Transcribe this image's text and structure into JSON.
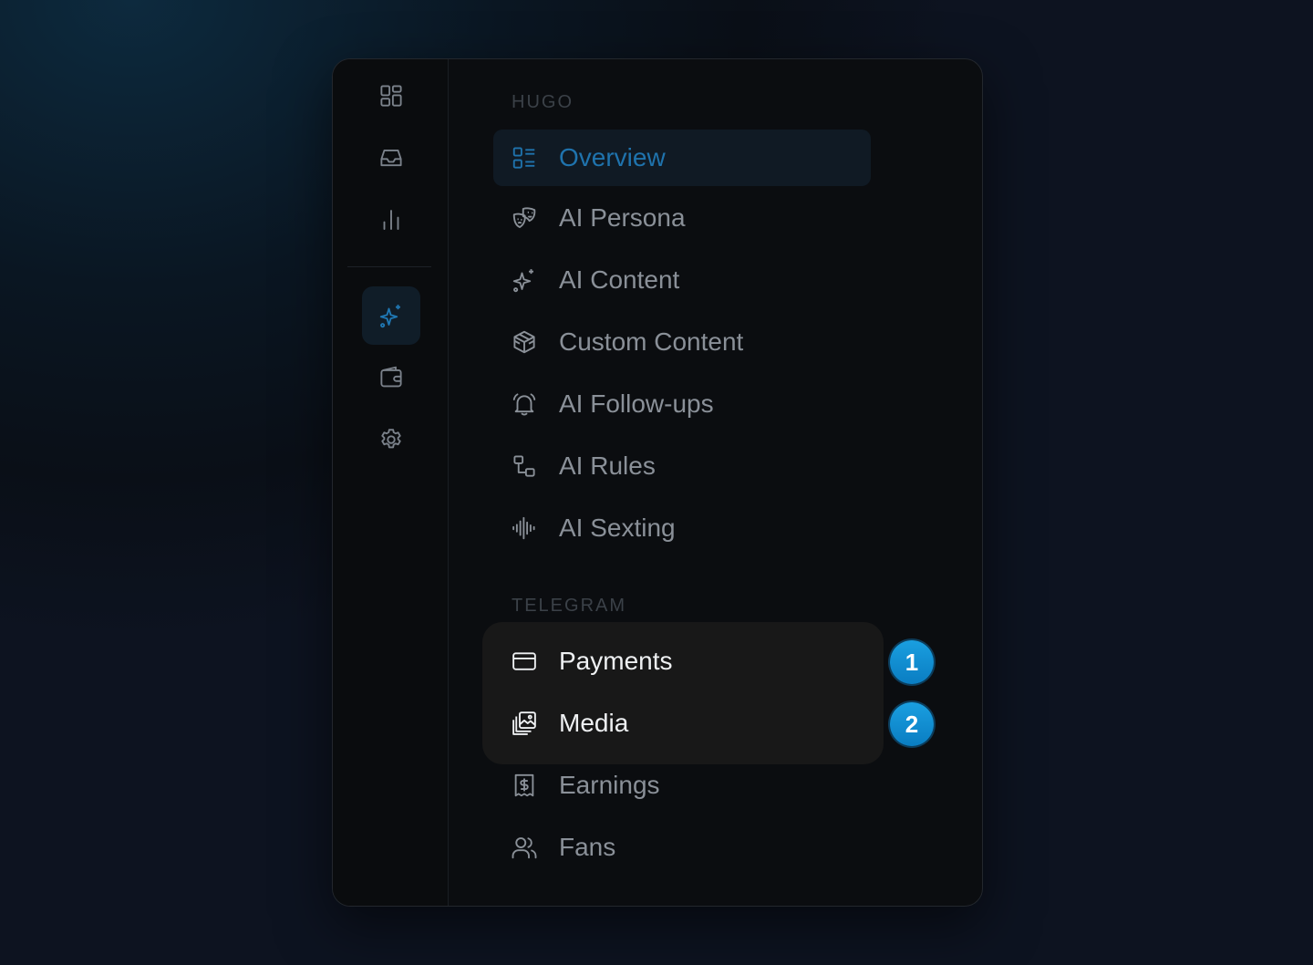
{
  "rail": {
    "items": [
      {
        "icon": "grid-icon"
      },
      {
        "icon": "inbox-icon"
      },
      {
        "icon": "bar-chart-icon"
      },
      {
        "icon": "sparkles-icon",
        "active": true
      },
      {
        "icon": "wallet-icon"
      },
      {
        "icon": "gear-icon"
      }
    ]
  },
  "sections": {
    "hugo": {
      "title": "HUGO",
      "items": [
        {
          "label": "Overview",
          "icon": "list-grid-icon",
          "active": true
        },
        {
          "label": "AI Persona",
          "icon": "masks-icon"
        },
        {
          "label": "AI Content",
          "icon": "sparkles-icon"
        },
        {
          "label": "Custom Content",
          "icon": "package-icon"
        },
        {
          "label": "AI Follow-ups",
          "icon": "bell-ringing-icon"
        },
        {
          "label": "AI Rules",
          "icon": "flow-icon"
        },
        {
          "label": "AI Sexting",
          "icon": "waveform-icon"
        }
      ]
    },
    "telegram": {
      "title": "TELEGRAM",
      "items": [
        {
          "label": "Payments",
          "icon": "credit-card-icon"
        },
        {
          "label": "Media",
          "icon": "images-icon"
        },
        {
          "label": "Earnings",
          "icon": "receipt-dollar-icon"
        },
        {
          "label": "Fans",
          "icon": "users-icon"
        }
      ]
    }
  },
  "badges": [
    "1",
    "2"
  ],
  "colors": {
    "accent": "#1f78b4",
    "badge": "#1093d6"
  }
}
